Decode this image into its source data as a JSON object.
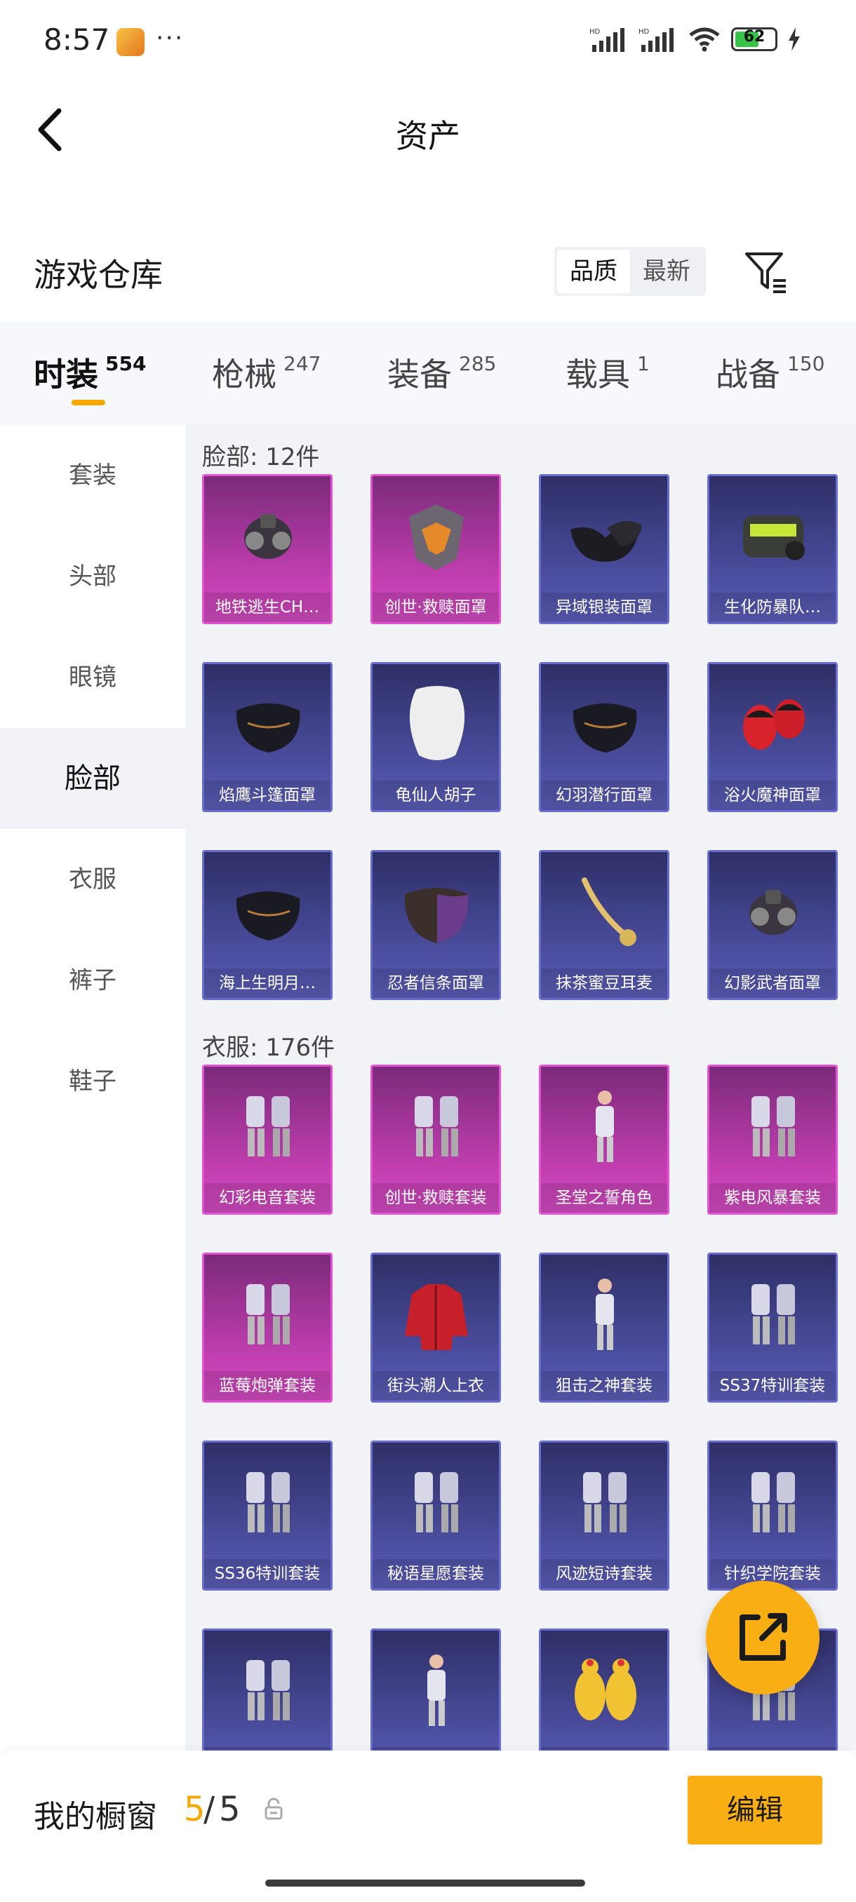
{
  "status": {
    "time": "8:57",
    "dots": "···",
    "battery": "62",
    "battery_level": 0.62
  },
  "header": {
    "title": "资产"
  },
  "warehouse": {
    "title": "游戏仓库",
    "sort": [
      "品质",
      "最新"
    ]
  },
  "tabs": [
    {
      "label": "时装",
      "count": "554"
    },
    {
      "label": "枪械",
      "count": "247"
    },
    {
      "label": "装备",
      "count": "285"
    },
    {
      "label": "载具",
      "count": "1"
    },
    {
      "label": "战备",
      "count": "150"
    }
  ],
  "sidebar": [
    "套装",
    "头部",
    "眼镜",
    "脸部",
    "衣服",
    "裤子",
    "鞋子"
  ],
  "sections": [
    {
      "title": "脸部: 12件",
      "items": [
        {
          "name": "地铁逃生CH…",
          "rarity": "pink",
          "icon": "gas-mask-icon"
        },
        {
          "name": "创世·救赎面罩",
          "rarity": "pink",
          "icon": "armored-mask-icon"
        },
        {
          "name": "异域银装面罩",
          "rarity": "blue",
          "icon": "half-mask-icon"
        },
        {
          "name": "生化防暴队…",
          "rarity": "blue",
          "icon": "riot-mask-icon"
        },
        {
          "name": "焰鹰斗篷面罩",
          "rarity": "blue",
          "icon": "cloth-mask-icon"
        },
        {
          "name": "龟仙人胡子",
          "rarity": "blue",
          "icon": "beard-icon"
        },
        {
          "name": "幻羽潜行面罩",
          "rarity": "blue",
          "icon": "cloth-mask-icon"
        },
        {
          "name": "浴火魔神面罩",
          "rarity": "blue",
          "icon": "demon-mask-icon"
        },
        {
          "name": "海上生明月…",
          "rarity": "blue",
          "icon": "cloth-mask-icon"
        },
        {
          "name": "忍者信条面罩",
          "rarity": "blue",
          "icon": "ninja-mask-icon"
        },
        {
          "name": "抹茶蜜豆耳麦",
          "rarity": "blue",
          "icon": "mic-icon"
        },
        {
          "name": "幻影武者面罩",
          "rarity": "blue",
          "icon": "gas-mask-icon"
        }
      ]
    },
    {
      "title": "衣服: 176件",
      "items": [
        {
          "name": "幻彩电音套装",
          "rarity": "pink",
          "icon": "outfit-icon"
        },
        {
          "name": "创世·救赎套装",
          "rarity": "pink",
          "icon": "outfit-icon"
        },
        {
          "name": "圣堂之誓角色",
          "rarity": "pink",
          "icon": "character-icon"
        },
        {
          "name": "紫电风暴套装",
          "rarity": "pink",
          "icon": "outfit-icon"
        },
        {
          "name": "蓝莓炮弹套装",
          "rarity": "pink",
          "icon": "outfit-icon"
        },
        {
          "name": "街头潮人上衣",
          "rarity": "blue",
          "icon": "jacket-icon"
        },
        {
          "name": "狙击之神套装",
          "rarity": "blue",
          "icon": "character-icon"
        },
        {
          "name": "SS37特训套装",
          "rarity": "blue",
          "icon": "outfit-icon"
        },
        {
          "name": "SS36特训套装",
          "rarity": "blue",
          "icon": "outfit-icon"
        },
        {
          "name": "秘语星愿套装",
          "rarity": "blue",
          "icon": "outfit-icon"
        },
        {
          "name": "风迹短诗套装",
          "rarity": "blue",
          "icon": "outfit-icon"
        },
        {
          "name": "针织学院套装",
          "rarity": "blue",
          "icon": "outfit-icon"
        },
        {
          "name": "",
          "rarity": "blue",
          "icon": "outfit-icon"
        },
        {
          "name": "",
          "rarity": "blue",
          "icon": "character-icon"
        },
        {
          "name": "",
          "rarity": "blue",
          "icon": "chicken-costume-icon"
        },
        {
          "name": "",
          "rarity": "blue",
          "icon": "outfit-icon"
        }
      ]
    }
  ],
  "bottom": {
    "label": "我的橱窗",
    "current": "5",
    "separator": "/",
    "max": "5",
    "edit": "编辑"
  },
  "colors": {
    "accent": "#f9ae14",
    "rare_pink": "#c43fb2",
    "rare_blue": "#4d4fa2"
  }
}
